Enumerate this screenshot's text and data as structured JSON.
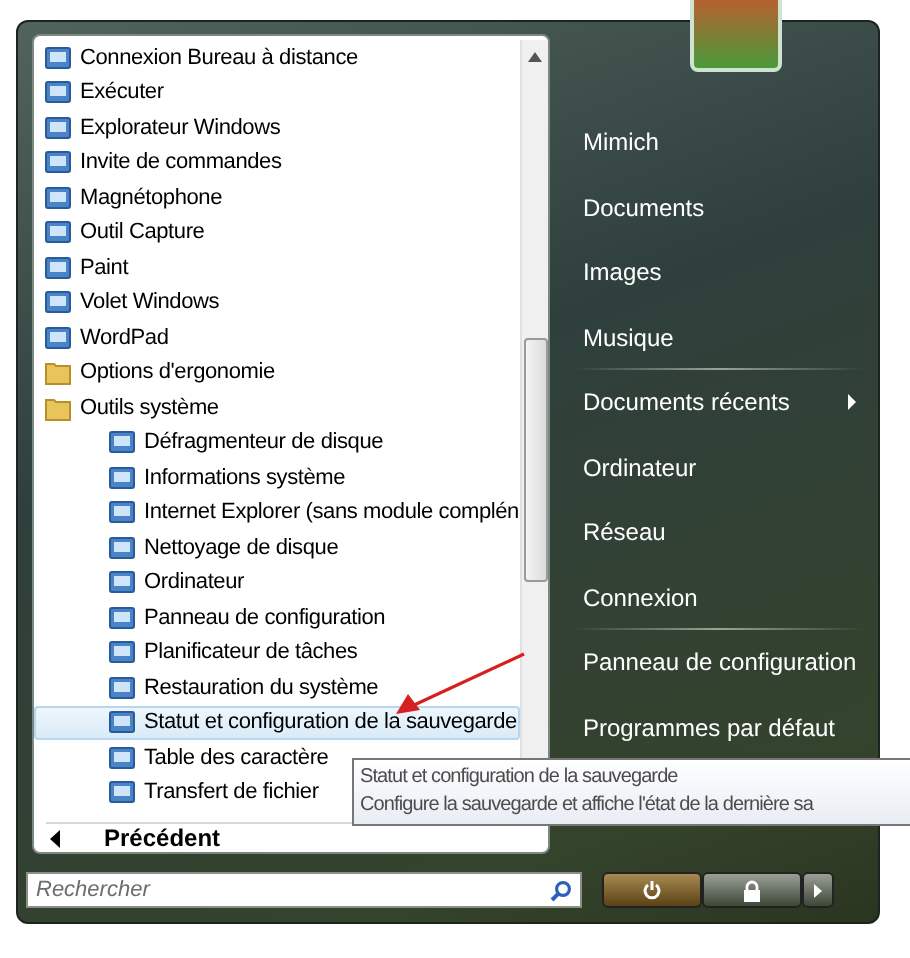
{
  "programs": [
    {
      "label": "Connexion Bureau à distance",
      "kind": "app",
      "selected": false
    },
    {
      "label": "Exécuter",
      "kind": "app",
      "selected": false
    },
    {
      "label": "Explorateur Windows",
      "kind": "app",
      "selected": false
    },
    {
      "label": "Invite de commandes",
      "kind": "app",
      "selected": false
    },
    {
      "label": "Magnétophone",
      "kind": "app",
      "selected": false
    },
    {
      "label": "Outil Capture",
      "kind": "app",
      "selected": false
    },
    {
      "label": "Paint",
      "kind": "app",
      "selected": false
    },
    {
      "label": "Volet Windows",
      "kind": "app",
      "selected": false
    },
    {
      "label": "WordPad",
      "kind": "app",
      "selected": false
    },
    {
      "label": "Options d'ergonomie",
      "kind": "folder",
      "selected": false
    },
    {
      "label": "Outils système",
      "kind": "folder",
      "selected": false,
      "children": [
        {
          "label": "Défragmenteur de disque",
          "kind": "app",
          "selected": false
        },
        {
          "label": "Informations système",
          "kind": "app",
          "selected": false
        },
        {
          "label": "Internet Explorer (sans module complén",
          "kind": "app",
          "selected": false
        },
        {
          "label": "Nettoyage de disque",
          "kind": "app",
          "selected": false
        },
        {
          "label": "Ordinateur",
          "kind": "app",
          "selected": false
        },
        {
          "label": "Panneau de configuration",
          "kind": "app",
          "selected": false
        },
        {
          "label": "Planificateur de tâches",
          "kind": "app",
          "selected": false
        },
        {
          "label": "Restauration du système",
          "kind": "app",
          "selected": false
        },
        {
          "label": "Statut et configuration de la sauvegarde",
          "kind": "app",
          "selected": true
        },
        {
          "label": "Table des caractère",
          "kind": "app",
          "selected": false
        },
        {
          "label": "Transfert de fichier",
          "kind": "app",
          "selected": false
        }
      ]
    }
  ],
  "back": {
    "label": "Précédent"
  },
  "search": {
    "placeholder": "Rechercher"
  },
  "places": [
    {
      "label": "Mimich",
      "submenu": false,
      "separator_after": false
    },
    {
      "label": "Documents",
      "submenu": false,
      "separator_after": false
    },
    {
      "label": "Images",
      "submenu": false,
      "separator_after": false
    },
    {
      "label": "Musique",
      "submenu": false,
      "separator_after": true
    },
    {
      "label": "Documents récents",
      "submenu": true,
      "separator_after": false
    },
    {
      "label": "Ordinateur",
      "submenu": false,
      "separator_after": false
    },
    {
      "label": "Réseau",
      "submenu": false,
      "separator_after": false
    },
    {
      "label": "Connexion",
      "submenu": false,
      "separator_after": true
    },
    {
      "label": "Panneau de configuration",
      "submenu": false,
      "separator_after": false
    },
    {
      "label": "Programmes par défaut",
      "submenu": false,
      "separator_after": false
    }
  ],
  "tooltip": {
    "title": "Statut et configuration de la sauvegarde",
    "description": "Configure la sauvegarde et affiche l'état de la dernière sa"
  }
}
